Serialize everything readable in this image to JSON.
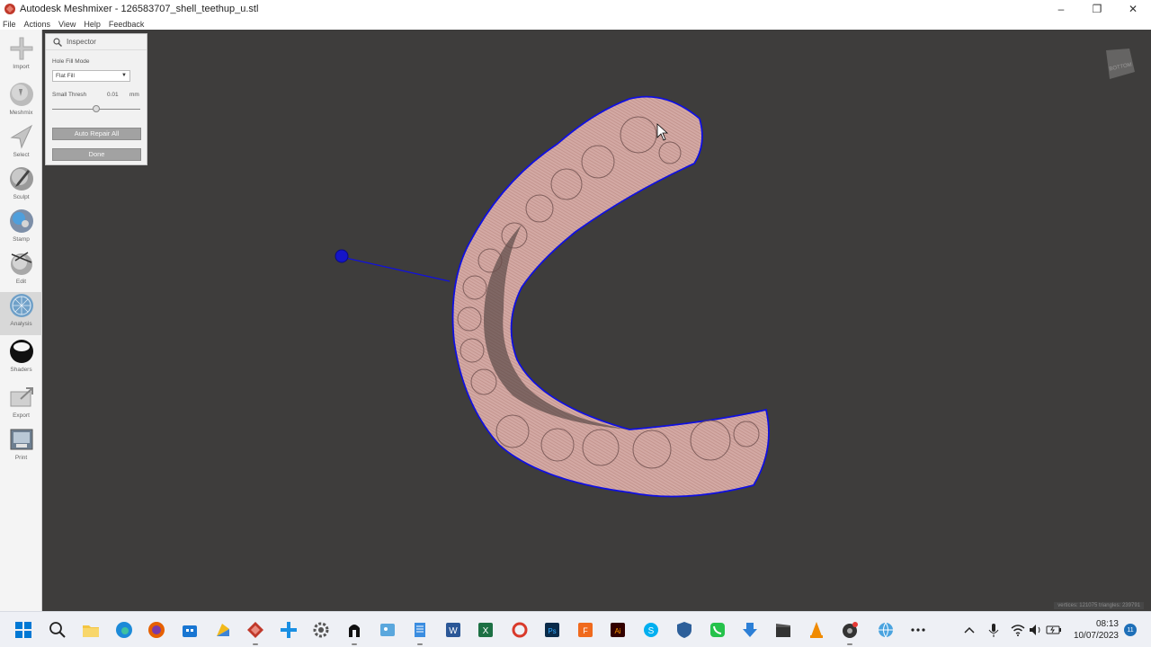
{
  "window": {
    "title": "Autodesk Meshmixer - 126583707_shell_teethup_u.stl",
    "controls": [
      "–",
      "❐",
      "✕"
    ]
  },
  "menu": [
    "File",
    "Actions",
    "View",
    "Help",
    "Feedback"
  ],
  "tools": [
    {
      "label": "Import",
      "icon": "plus-icon"
    },
    {
      "label": "Meshmix",
      "icon": "meshmix-icon"
    },
    {
      "label": "Select",
      "icon": "select-arrow-icon"
    },
    {
      "label": "Sculpt",
      "icon": "sculpt-brush-icon"
    },
    {
      "label": "Stamp",
      "icon": "stamp-icon"
    },
    {
      "label": "Edit",
      "icon": "edit-icon"
    },
    {
      "label": "Analysis",
      "icon": "analysis-icon"
    },
    {
      "label": "Shaders",
      "icon": "shaders-sphere-icon"
    },
    {
      "label": "Export",
      "icon": "export-icon"
    },
    {
      "label": "Print",
      "icon": "print-icon"
    }
  ],
  "active_tool": "Analysis",
  "inspector": {
    "title": "Inspector",
    "hole_fill_mode_label": "Hole Fill Mode",
    "hole_fill_mode_value": "Flat Fill",
    "small_thresh_label": "Small Thresh",
    "small_thresh_value": "0.01",
    "small_thresh_unit": "mm",
    "slider_fraction": 0.5,
    "auto_repair_label": "Auto Repair All",
    "done_label": "Done"
  },
  "viewcube_label": "BOTTOM",
  "status_text": "vertices: 121075 triangles: 239791",
  "taskbar": {
    "time": "08:13",
    "date": "10/07/2023",
    "notification_count": "11"
  },
  "colors": {
    "viewport_bg": "#3e3d3c",
    "mesh_fill": "#d3a9a4",
    "boundary": "#1010e0",
    "accent": "#0067c0"
  }
}
